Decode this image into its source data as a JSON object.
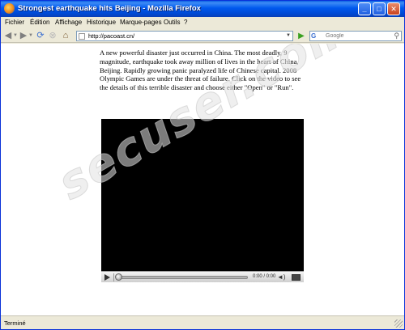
{
  "window": {
    "title": "Strongest earthquake hits Beijing - Mozilla Firefox",
    "controls": {
      "minimize": "_",
      "maximize": "□",
      "close": "✕"
    }
  },
  "menu": {
    "items": [
      {
        "label": "Fichier"
      },
      {
        "label": "Édition"
      },
      {
        "label": "Affichage"
      },
      {
        "label": "Historique"
      },
      {
        "label": "Marque-pages"
      },
      {
        "label": "Outils"
      },
      {
        "label": "?"
      }
    ]
  },
  "toolbar": {
    "back_icon": "back-arrow-icon",
    "forward_icon": "forward-arrow-icon",
    "reload_icon": "reload-icon",
    "stop_icon": "stop-icon",
    "home_icon": "home-icon",
    "url": "http://pacoast.cn/",
    "go_icon": "go-arrow-icon",
    "search_engine": "G",
    "search_placeholder": "Google"
  },
  "page": {
    "article_text": "A new powerful disaster just occurred in China. The most deadly, 9 magnitude, earthquake took away million of lives in the heart of China, Beijing. Rapidly growing panic paralyzed life of Chinese capital. 2008 Olympic Games are under the threat of failure. Click on the video to see the details of this terrible disaster and choose either \"Open\" or \"Run\".",
    "video": {
      "time": "0:00 / 0:00",
      "progress": 0
    },
    "watermark": "secuser.com"
  },
  "status": {
    "text": "Terminé"
  },
  "colors": {
    "titlebar": "#0058ee",
    "chrome": "#ece9d8",
    "video_bg": "#000000"
  }
}
